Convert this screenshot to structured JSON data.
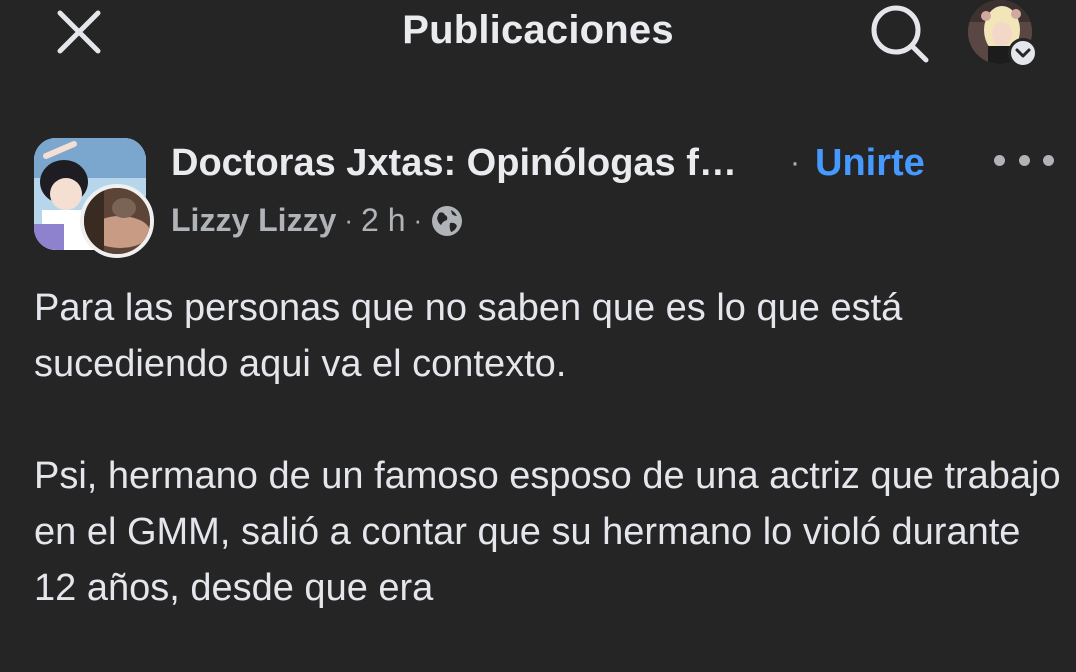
{
  "header": {
    "title": "Publicaciones"
  },
  "post": {
    "group_name": "Doctoras Jxtas: Opinólogas f…",
    "separator": "·",
    "join_label": "Unirte",
    "author": "Lizzy Lizzy",
    "time": "2 h",
    "paragraphs": [
      "Para las personas que no saben que es lo que está sucediendo aqui va el contexto.",
      "Psi, hermano de un famoso esposo de una actriz que trabajo en el GMM,  salió a contar que su hermano lo violó durante 12 años, desde que era"
    ]
  },
  "icons": {
    "close": "close-icon",
    "search": "search-icon",
    "chevron": "chevron-down-icon",
    "more": "more-options-icon",
    "audience": "globe-icon"
  },
  "colors": {
    "background": "#252526",
    "text": "#e4e6eb",
    "secondary_text": "#b0b3b8",
    "accent": "#4599ff"
  }
}
